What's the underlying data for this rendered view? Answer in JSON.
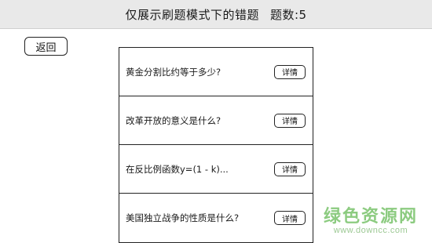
{
  "header": {
    "title": "仅展示刷题模式下的错题",
    "count_text": "题数:5"
  },
  "back_label": "返回",
  "questions": [
    {
      "text": "黄金分割比约等于多少?",
      "button": "详情"
    },
    {
      "text": "改革开放的意义是什么?",
      "button": "详情"
    },
    {
      "text": "在反比例函数y=(1 - k)...",
      "button": "详情"
    },
    {
      "text": "美国独立战争的性质是什么?",
      "button": "详情"
    }
  ],
  "watermark": {
    "main": "绿色资源网",
    "url": "www.downcc.com"
  }
}
